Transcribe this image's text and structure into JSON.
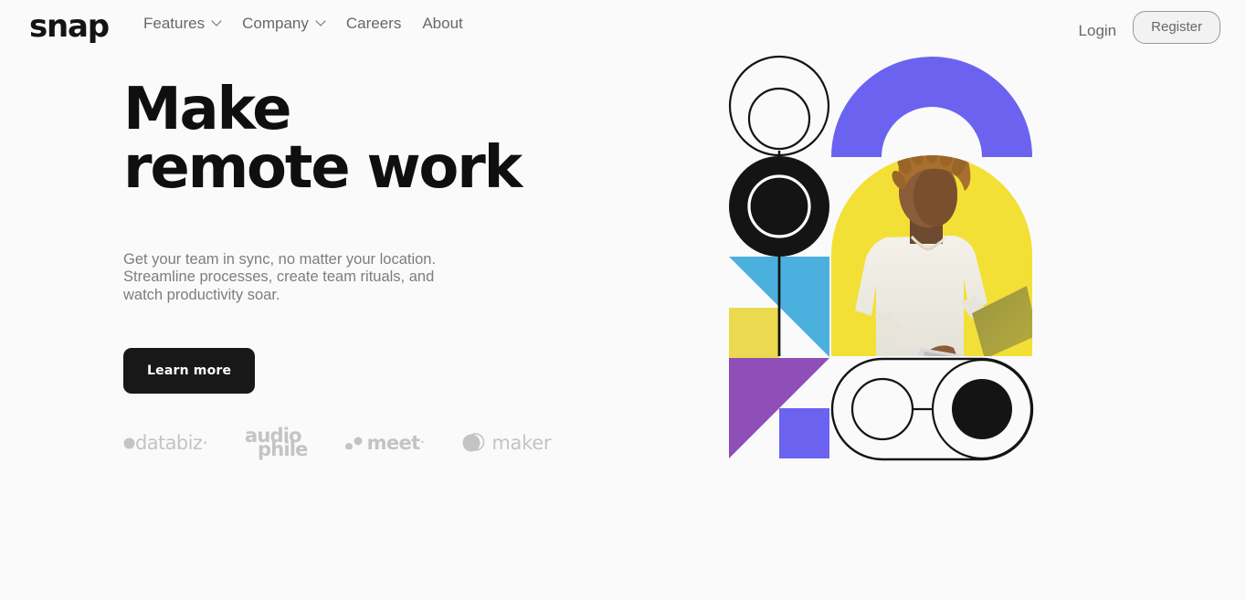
{
  "brand": {
    "logo_text": "snap"
  },
  "nav": {
    "items": [
      {
        "label": "Features",
        "has_chevron": true,
        "icon": "chevron-down-icon"
      },
      {
        "label": "Company",
        "has_chevron": true,
        "icon": "chevron-down-icon"
      },
      {
        "label": "Careers",
        "has_chevron": false
      },
      {
        "label": "About",
        "has_chevron": false
      }
    ],
    "login_label": "Login",
    "register_label": "Register"
  },
  "hero": {
    "title": "Make\nremote work",
    "subtitle": "Get your team in sync, no matter your location.\nStreamline processes, create team rituals, and\nwatch productivity soar.",
    "cta_label": "Learn more"
  },
  "clients": [
    {
      "name": "databiz",
      "label": "databiz",
      "icon": "dot-mark-icon"
    },
    {
      "name": "audiophile",
      "label_top": "audio",
      "label_bottom": "phile",
      "icon": "dot-mark-icon"
    },
    {
      "name": "meet",
      "label": "meet",
      "icon": "two-dots-icon"
    },
    {
      "name": "maker",
      "label": "maker",
      "icon": "circle-overlap-icon"
    }
  ],
  "graphic": {
    "alt": "abstract geometric collage with photo of person using a laptop",
    "colors": {
      "periwinkle": "#6B63F0",
      "yellow": "#F3E036",
      "soft_yellow": "#EBD94F",
      "cyan": "#4CB0DE",
      "violet": "#8F4EB8",
      "black": "#141414",
      "background": "#fafafa"
    },
    "shapes": [
      {
        "name": "outline-double-circle",
        "type": "rings"
      },
      {
        "name": "purple-arch",
        "type": "arch",
        "color": "#6B63F0"
      },
      {
        "name": "black-donut",
        "type": "donut",
        "color": "#141414"
      },
      {
        "name": "yellow-arch-photo",
        "type": "arch-photo",
        "color": "#F3E036"
      },
      {
        "name": "cyan-triangle",
        "type": "triangle",
        "color": "#4CB0DE"
      },
      {
        "name": "yellow-square",
        "type": "square",
        "color": "#EBD94F"
      },
      {
        "name": "violet-triangle",
        "type": "triangle",
        "color": "#8F4EB8"
      },
      {
        "name": "periwinkle-square",
        "type": "square",
        "color": "#6B63F0"
      },
      {
        "name": "outline-pill",
        "type": "pill"
      },
      {
        "name": "black-dot",
        "type": "circle",
        "color": "#141414"
      }
    ]
  },
  "theme": {
    "page_background": "#fafafa",
    "text_primary": "#0f0f0f",
    "text_muted": "#7d7d7d",
    "cta_background": "#181818"
  }
}
